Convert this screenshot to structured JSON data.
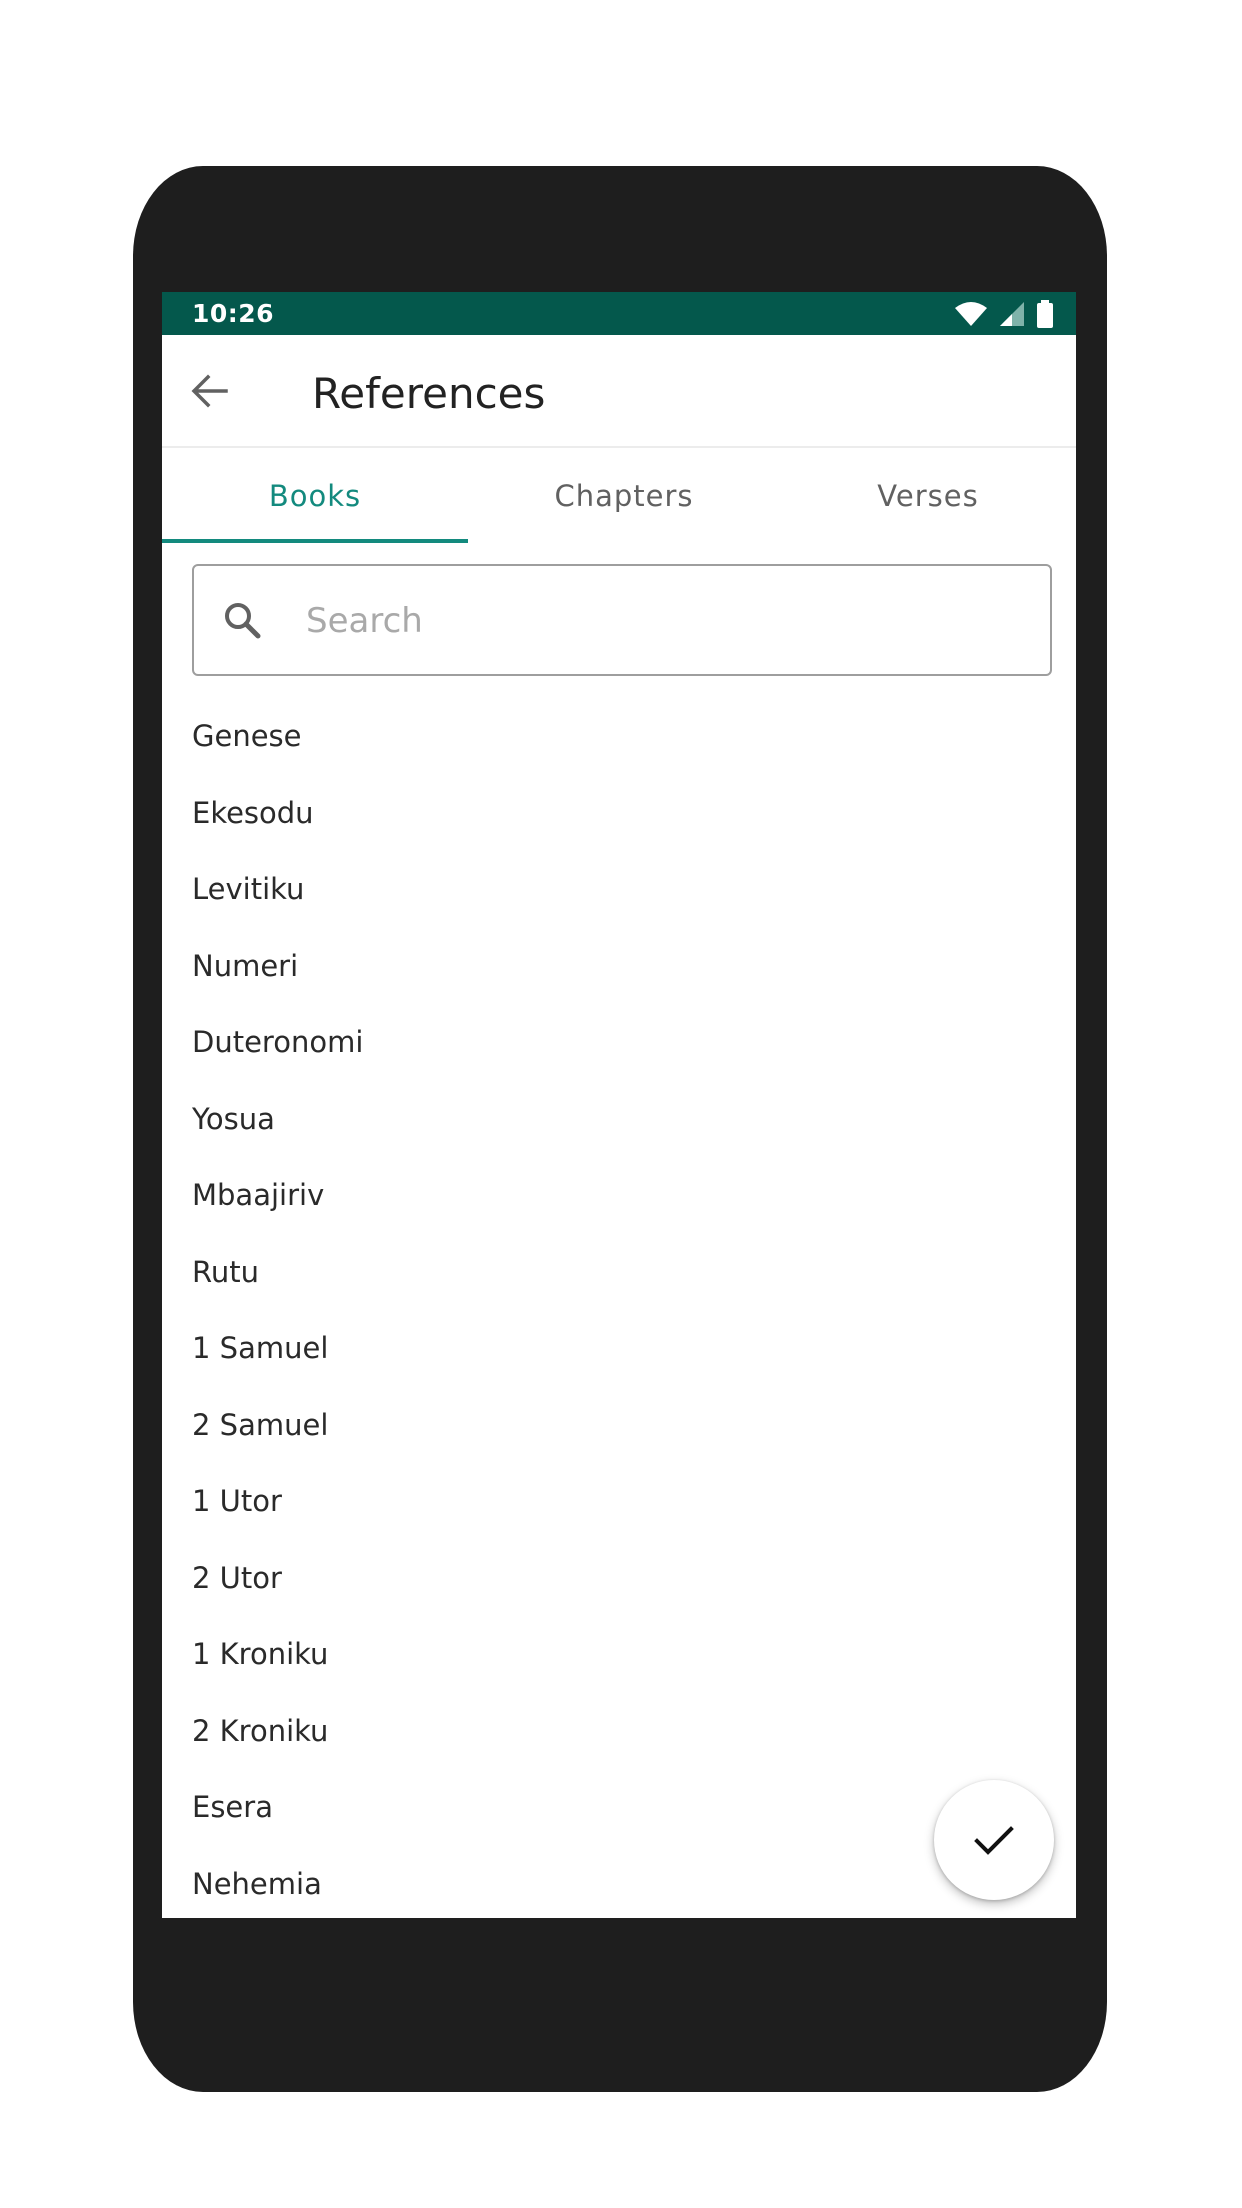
{
  "status_bar": {
    "time": "10:26"
  },
  "app_bar": {
    "title": "References"
  },
  "tabs": [
    {
      "label": "Books",
      "active": true
    },
    {
      "label": "Chapters",
      "active": false
    },
    {
      "label": "Verses",
      "active": false
    }
  ],
  "search": {
    "placeholder": "Search",
    "value": ""
  },
  "books": [
    "Genese",
    "Ekesodu",
    "Levitiku",
    "Numeri",
    "Duteronomi",
    "Yosua",
    "Mbaajiriv",
    "Rutu",
    "1 Samuel",
    "2 Samuel",
    "1 Utor",
    "2 Utor",
    "1 Kroniku",
    "2 Kroniku",
    "Esera",
    "Nehemia"
  ],
  "colors": {
    "status_bar": "#04584c",
    "accent": "#138a7e",
    "device": "#1e1e1e"
  },
  "icons": {
    "back": "arrow-back-icon",
    "search": "search-icon",
    "confirm": "check-icon"
  }
}
